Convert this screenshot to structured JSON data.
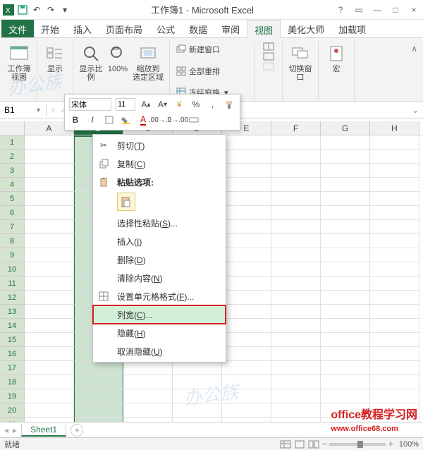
{
  "title": "工作簿1 - Microsoft Excel",
  "menubar": {
    "file": "文件",
    "tabs": [
      "开始",
      "插入",
      "页面布局",
      "公式",
      "数据",
      "审阅",
      "视图",
      "美化大师",
      "加载项"
    ],
    "active_index": 6
  },
  "ribbon": {
    "group1": {
      "big": "工作簿视图",
      "small": "显示"
    },
    "zoom": {
      "label": "显示比例",
      "hundred": "100%",
      "fit": "缩放到\n选定区域"
    },
    "window": {
      "new": "新建窗口",
      "arrange": "全部重排",
      "freeze": "冻结窗格",
      "switch": "切换窗口"
    },
    "macro": "宏"
  },
  "namebox": "B1",
  "mini_toolbar": {
    "font": "宋体",
    "size": "11",
    "buttons": [
      "B",
      "I"
    ]
  },
  "columns": [
    "A",
    "B",
    "C",
    "D",
    "E",
    "F",
    "G",
    "H"
  ],
  "selected_col_index": 1,
  "row_count": 21,
  "context_menu": {
    "cut": "剪切(T)",
    "copy": "复制(C)",
    "paste_header": "粘贴选项:",
    "paste_special": "选择性粘贴(S)...",
    "insert": "插入(I)",
    "delete": "删除(D)",
    "clear": "清除内容(N)",
    "format": "设置单元格格式(F)...",
    "colwidth": "列宽(C)...",
    "hide": "隐藏(H)",
    "unhide": "取消隐藏(U)"
  },
  "sheet": {
    "name": "Sheet1"
  },
  "status": {
    "ready": "就绪",
    "zoom": "100%"
  },
  "footer": {
    "text": "office教程学习网",
    "url": "www.office68.com"
  }
}
